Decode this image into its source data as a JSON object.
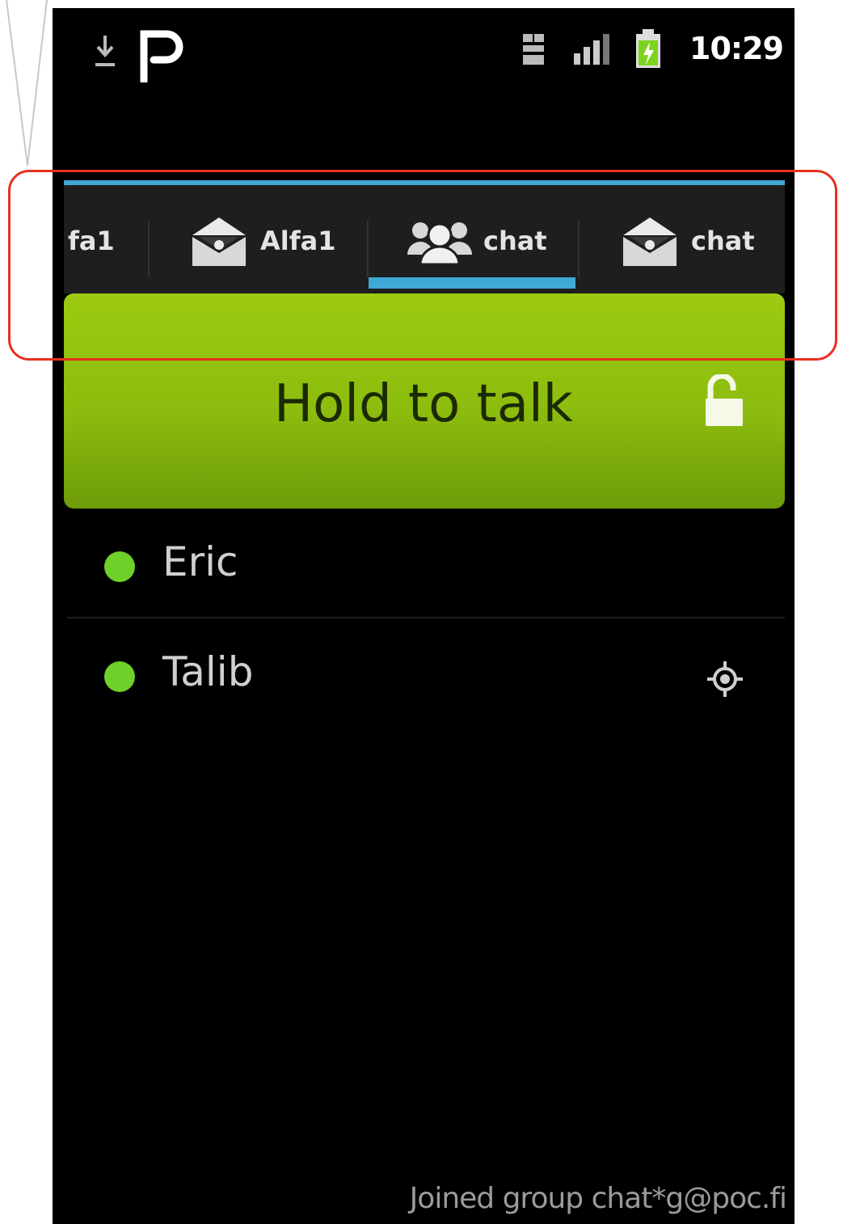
{
  "status_bar": {
    "time": "10:29"
  },
  "tabs": [
    {
      "label": "fa1",
      "icon": "envelope-icon",
      "selected": false
    },
    {
      "label": "Alfa1",
      "icon": "envelope-icon",
      "selected": false
    },
    {
      "label": "chat",
      "icon": "group-icon",
      "selected": true
    },
    {
      "label": "chat",
      "icon": "envelope-icon",
      "selected": false
    }
  ],
  "ptt_button": {
    "label": "Hold to talk",
    "icon": "lock-open-icon",
    "color": "#8fc00e"
  },
  "members": [
    {
      "name": "Eric",
      "status_color": "#6fd02a",
      "location_icon": false
    },
    {
      "name": "Talib",
      "status_color": "#6fd02a",
      "location_icon": true
    }
  ],
  "status_message": "Joined group chat*g@poc.fi",
  "colors": {
    "accent": "#3fa9d6",
    "highlight": "#e83020"
  }
}
